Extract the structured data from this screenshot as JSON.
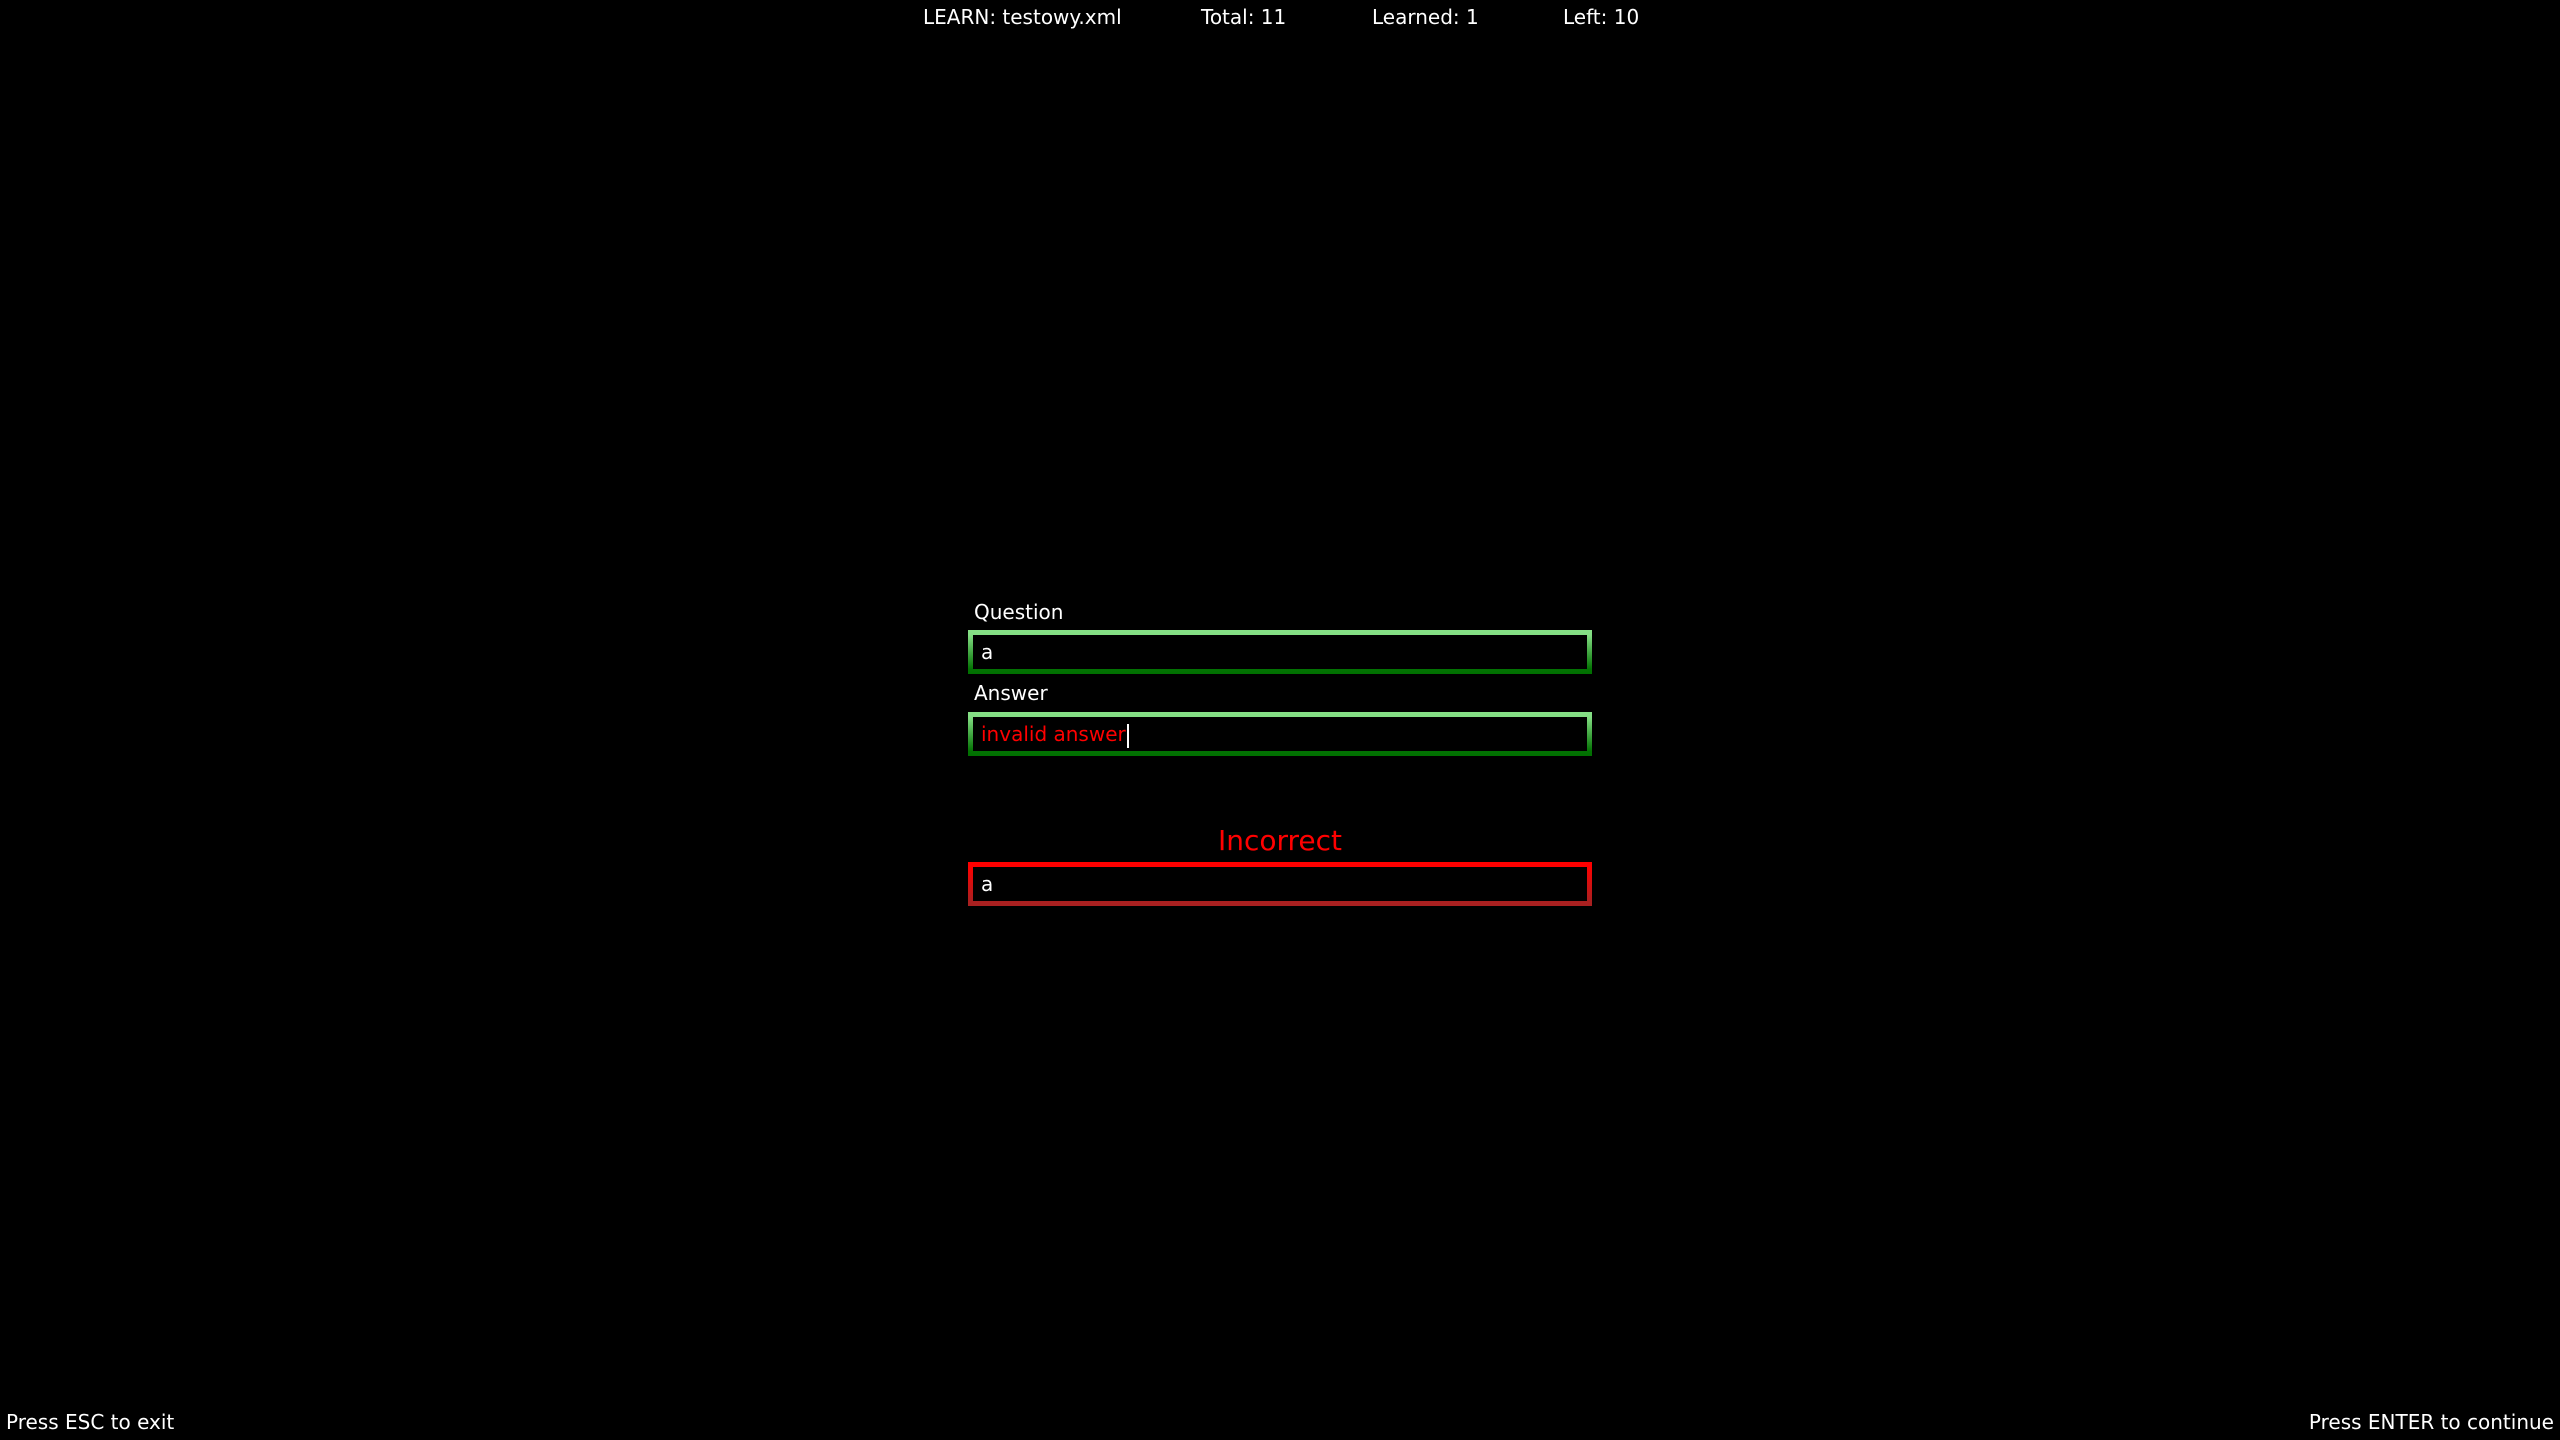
{
  "header": {
    "mode": "LEARN: testowy.xml",
    "total": "Total: 11",
    "learned": "Learned: 1",
    "left": "Left: 10"
  },
  "form": {
    "question_label": "Question",
    "question_value": "a",
    "answer_label": "Answer",
    "answer_value": "invalid answer"
  },
  "result": {
    "status": "Incorrect",
    "correct_answer": "a"
  },
  "footer": {
    "exit_hint": "Press ESC to exit",
    "continue_hint": "Press ENTER to continue"
  },
  "colors": {
    "ok": "#008000",
    "error": "#ff0000"
  }
}
